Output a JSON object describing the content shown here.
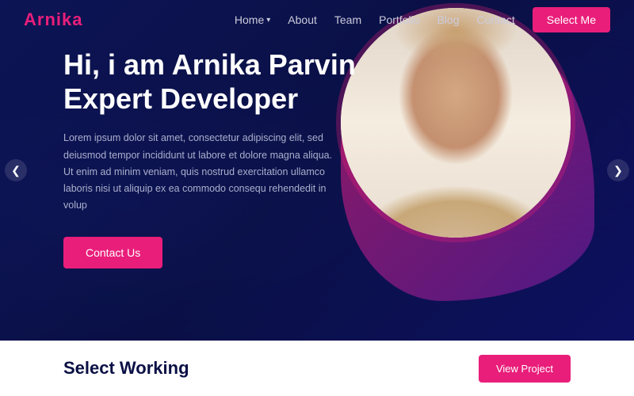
{
  "brand": {
    "name_start": "Arn",
    "name_highlight": "ika"
  },
  "nav": {
    "home_label": "Home",
    "about_label": "About",
    "team_label": "Team",
    "portfolio_label": "Portfolio",
    "blog_label": "Blog",
    "contact_label": "Contact",
    "select_me_label": "Select Me"
  },
  "hero": {
    "title_line1": "Hi, i am Arnika Parvin",
    "title_line2": "Expert Developer",
    "description": "Lorem ipsum dolor sit amet, consectetur adipiscing elit, sed deiusmod tempor incididunt ut labore et dolore magna aliqua. Ut enim ad minim veniam, quis nostrud exercitation ullamco laboris nisi ut aliquip ex ea commodo consequ rehendedit in volup",
    "contact_btn_label": "Contact Us"
  },
  "arrows": {
    "left": "❮",
    "right": "❯"
  },
  "bottom": {
    "title": "Select Working",
    "view_btn_label": "View Project"
  }
}
